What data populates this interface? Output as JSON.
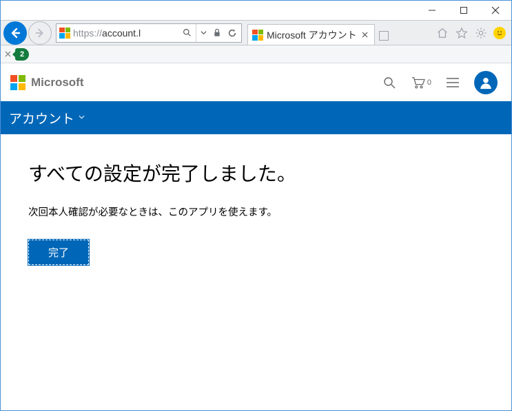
{
  "browser": {
    "url_prefix": "https://",
    "url_rest": "account.l",
    "tab_title": "Microsoft アカウント",
    "toolbar_badge": "2"
  },
  "header": {
    "brand": "Microsoft",
    "cart_count": "0"
  },
  "nav": {
    "section": "アカウント"
  },
  "main": {
    "headline": "すべての設定が完了しました。",
    "subtext": "次回本人確認が必要なときは、このアプリを使えます。",
    "done_label": "完了"
  },
  "colors": {
    "accent": "#0067b8"
  }
}
